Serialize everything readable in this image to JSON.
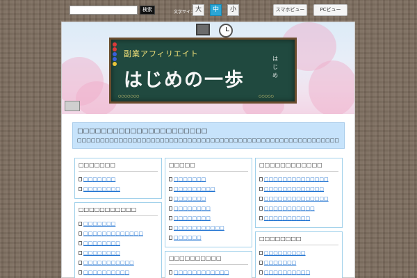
{
  "topbar": {
    "search_placeholder": "",
    "search_button": "検索",
    "fontsize_label": "文字サイズ→",
    "fontsize_buttons": [
      "大",
      "中",
      "小"
    ],
    "fontsize_active": "中",
    "smartphone_view": "スマホビュー",
    "pc_view": "PCビュー"
  },
  "header": {
    "subtitle": "副業アフィリエイト",
    "title": "はじめの一歩",
    "side_text": "は\nじ\nめ",
    "foot_left": "○○○○○○○",
    "foot_right": "○○○○○"
  },
  "intro": {
    "title": "□□□□□□□□□□□□□□□□□□□□□□",
    "text": "□□□□□□□□□□□□□□□□□□□□□□□□□□□□□□□□□□□□□□□□□□□□□□□□□□□□□□□□□ □□□□□□□□□□□□□□□□□□□"
  },
  "widgets": [
    {
      "title": "□□□□□□□",
      "items": [
        "□□□□□□□",
        "□□□□□□□□"
      ]
    },
    {
      "title": "□□□□□□□□□□□",
      "items": [
        "□□□□□□□",
        "□□□□□□□□□□□□□",
        "□□□□□□□□",
        "□□□□□□□□",
        "□□□□□□□□□□□",
        "□□□□□□□□□□"
      ]
    },
    {
      "title": "□□□□□",
      "items": [
        "□□□□□□□",
        "□□□□□□□□□",
        "□□□□□□□",
        "□□□□□□□□",
        "□□□□□□□□",
        "□□□□□□□□□□□",
        "□□□□□□"
      ]
    },
    {
      "title": "□□□□□□□□□□",
      "items": [
        "□□□□□□□□□□□□"
      ]
    },
    {
      "title": "□□□□□□□□□□□□",
      "items": [
        "□□□□□□□□□□□□□□",
        "□□□□□□□□□□□□□",
        "□□□□□□□□□□□□□□",
        "□□□□□□□□□□□",
        "□□□□□□□□□□"
      ]
    },
    {
      "title": "□□□□□□□□",
      "items": [
        "□□□□□□□□□",
        "□□□□□□□",
        "□□□□□□□□□□"
      ]
    }
  ],
  "colors": {
    "accent": "#2aa6d6",
    "intro_bg": "#c7e3fb",
    "link": "#1a6fd0",
    "widget_border": "#9fd0ea",
    "chalkboard": "#20493f"
  }
}
